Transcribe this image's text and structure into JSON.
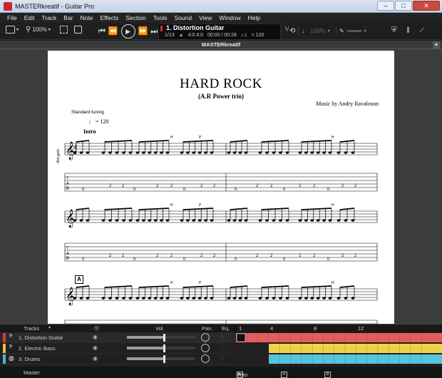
{
  "window": {
    "title": "MASTERkreatif - Guitar Pro",
    "buttons": [
      "–",
      "□",
      "✕"
    ]
  },
  "menu": [
    "File",
    "Edit",
    "Track",
    "Bar",
    "Note",
    "Effects",
    "Section",
    "Tools",
    "Sound",
    "View",
    "Window",
    "Help"
  ],
  "toolbar": {
    "zoom": "100%",
    "lcd": {
      "track_name": "1. Distortion Guitar",
      "bar_position": "1/13",
      "time_signature": "4:0.4:0",
      "time": "00:00 / 00:28",
      "tempo": "= 120"
    },
    "speed": "100%"
  },
  "document": {
    "tab_title": "MASTERkreatif",
    "add_tab": "+"
  },
  "score": {
    "title": "HARD ROCK",
    "subtitle": "(A.R Power trio)",
    "music_by": "Music by Andry Ravaloson",
    "tuning": "Standard tuning",
    "tempo": "♩ = 120",
    "section_intro": "Intro",
    "section_letter": "A",
    "instrument_label": "dist.guit."
  },
  "tracks_panel": {
    "headers": {
      "tracks": "Tracks",
      "vol": "Vol.",
      "pan": "Pan.",
      "eq": "Eq."
    },
    "bar_numbers": [
      "1",
      "4",
      "8",
      "12"
    ],
    "tracks": [
      {
        "name": "1. Distortion Guitar",
        "color": "#d93a3e",
        "icon": "guitar-icon",
        "volume": 0.55
      },
      {
        "name": "2. Electric Bass",
        "color": "#e7c23c",
        "icon": "bass-icon",
        "volume": 0.55
      },
      {
        "name": "3. Drums",
        "color": "#47b9d6",
        "icon": "drums-icon",
        "volume": 0.55
      }
    ],
    "master": {
      "label": "Master",
      "markers": [
        "Intro",
        "A",
        "B"
      ]
    }
  },
  "colors": {
    "guitar": "#e45d5d",
    "bass": "#f0d24a",
    "drums": "#58c3dd",
    "accent": "#d32c32"
  }
}
